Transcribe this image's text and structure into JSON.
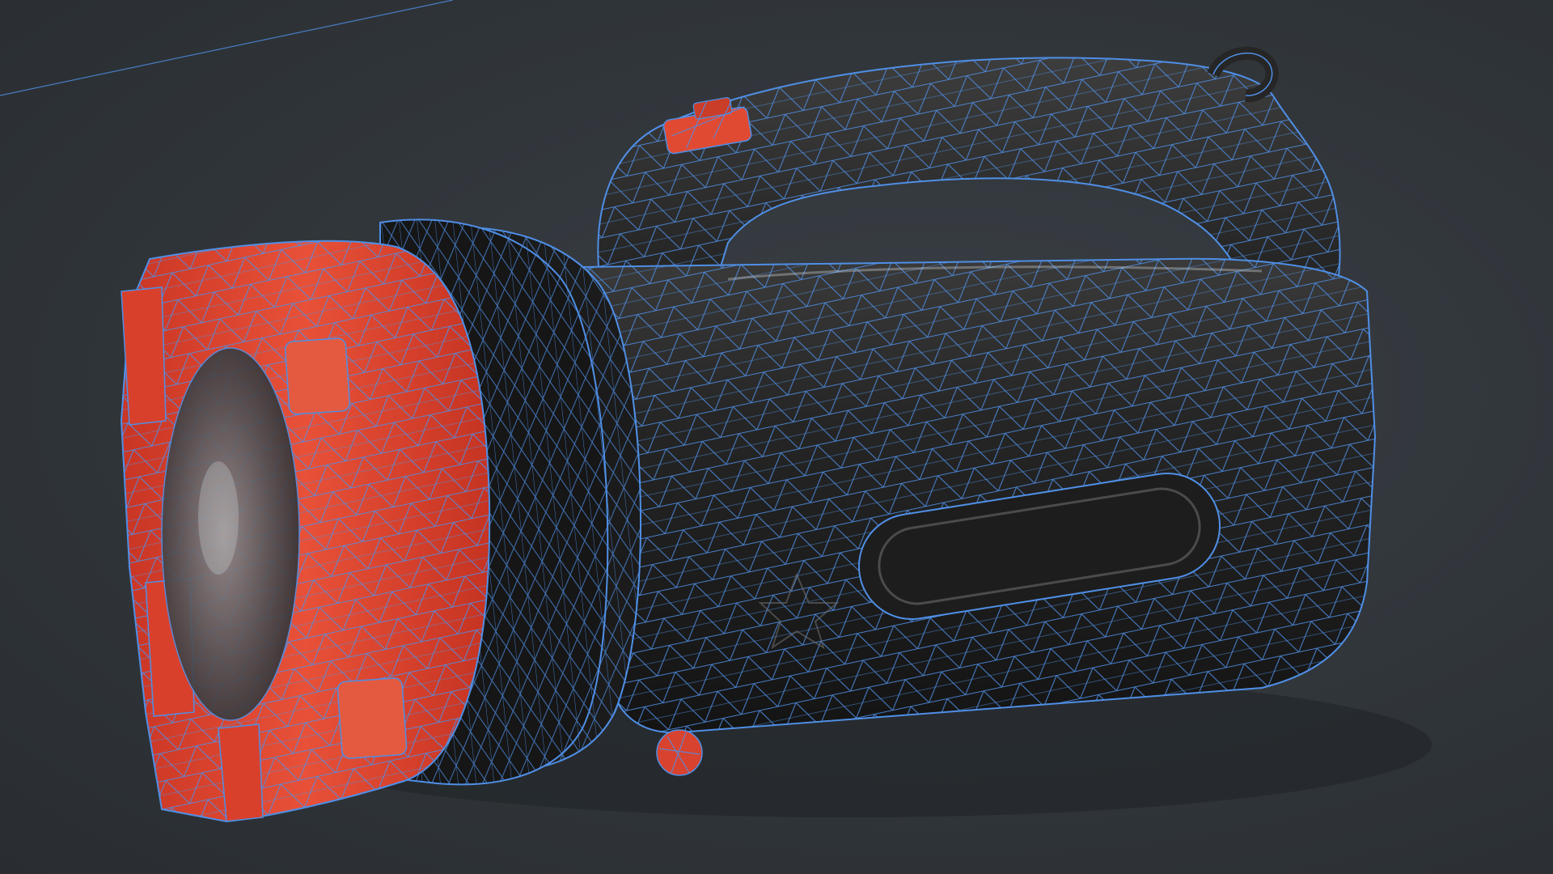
{
  "scene": {
    "subject": "flashlight-wireframe-render",
    "colors": {
      "background": "#31363b",
      "wire": "#4f8fe6",
      "body": "#1f1f1f",
      "accent": "#e24a33"
    }
  }
}
